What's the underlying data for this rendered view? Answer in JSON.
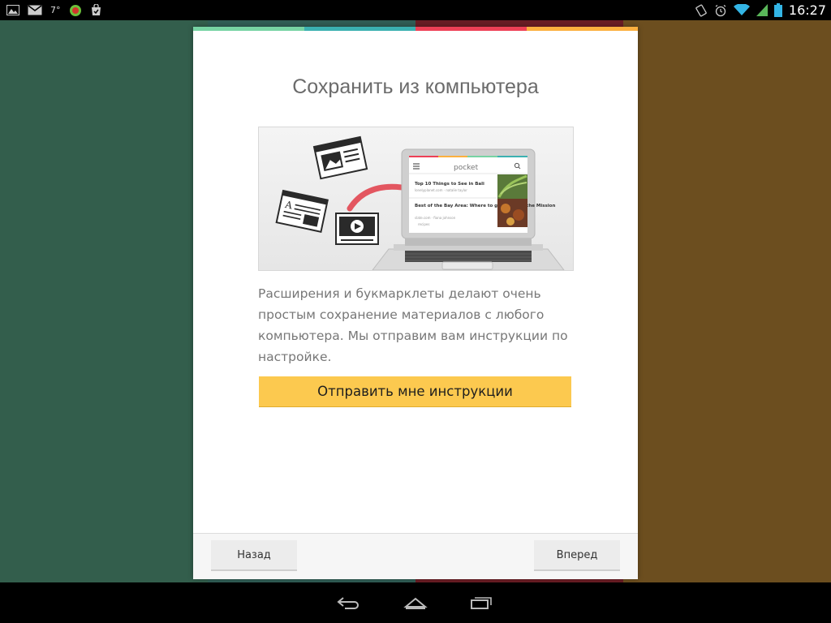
{
  "colors": {
    "panel_1": "#335e4c",
    "panel_2": "#305d55",
    "panel_3": "#6a1d24",
    "panel_4": "#6c4e1f",
    "stripe_1": "#77d3a3",
    "stripe_2": "#3bb1b1",
    "stripe_3": "#ee4056",
    "stripe_4": "#fcb03f",
    "accent_button": "#fcc94f"
  },
  "status_bar": {
    "left_icons": [
      "gallery-icon",
      "gmail-icon",
      "weather-icon",
      "app-icon",
      "play-store-icon"
    ],
    "temperature": "7°",
    "right_icons": [
      "rotation-icon",
      "alarm-icon",
      "wifi-icon",
      "signal-icon",
      "battery-icon"
    ],
    "time": "16:27"
  },
  "dialog": {
    "title": "Сохранить из компьютера",
    "illustration": {
      "app_name": "pocket",
      "item_1_title": "Top 10 Things to See in Bali",
      "item_1_meta": "lonelyplanet.com · natalie taylor",
      "item_2_title": "Best of the Bay Area: Where to get Tapas in the Mission",
      "item_2_meta": "slate.com · fiona johnson",
      "item_2_tag": "recipes"
    },
    "description": "Расширения и букмарклеты делают очень простым сохранение материалов с любого компьютера. Мы отправим вам инструкции по настройке.",
    "primary_button": "Отправить мне инструкции",
    "back_button": "Назад",
    "next_button": "Вперед"
  },
  "nav_bar": {
    "icons": [
      "back-icon",
      "home-icon",
      "recent-apps-icon"
    ]
  }
}
